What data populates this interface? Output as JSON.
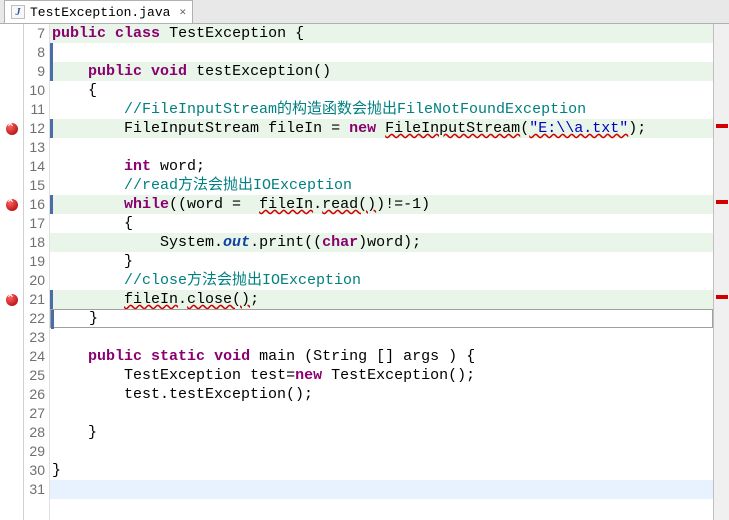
{
  "tab": {
    "filename": "TestException.java",
    "close_glyph": "✕"
  },
  "line_numbers": [
    "7",
    "8",
    "9",
    "10",
    "11",
    "12",
    "13",
    "14",
    "15",
    "16",
    "17",
    "18",
    "19",
    "20",
    "21",
    "22",
    "23",
    "24",
    "25",
    "26",
    "27",
    "28",
    "29",
    "30",
    "31"
  ],
  "gutter": {
    "error_lines": [
      12,
      16,
      21
    ]
  },
  "code": {
    "l7": {
      "kw1": "public",
      "kw2": "class",
      "name": "TestException",
      "brace": "{"
    },
    "l8": {
      "text": ""
    },
    "l9": {
      "kw1": "public",
      "kw2": "void",
      "name": "testException()"
    },
    "l10": {
      "brace": "{"
    },
    "l11": {
      "comment": "//FileInputStream的构造函数会抛出FileNotFoundException"
    },
    "l12": {
      "ty": "FileInputStream",
      "var": "fileIn",
      "eq": "=",
      "kw": "new",
      "ctor": "FileInputStream",
      "open": "(",
      "str": "\"E:\\\\a.txt\"",
      "close": ")",
      "semi": ";"
    },
    "l13": {
      "text": ""
    },
    "l14": {
      "kw": "int",
      "var": "word;"
    },
    "l15": {
      "comment": "//read方法会抛出IOException"
    },
    "l16": {
      "kw": "while",
      "open": "((word = ",
      "obj": "fileIn",
      "dot": ".",
      "meth": "read()",
      "rest": ")!=-1)"
    },
    "l17": {
      "brace": "{"
    },
    "l18": {
      "pre": "System.",
      "fld": "out",
      "mid": ".print((",
      "kw": "char",
      "post": ")word);"
    },
    "l19": {
      "brace": "}"
    },
    "l20": {
      "comment": "//close方法会抛出IOException"
    },
    "l21": {
      "obj": "fileIn",
      "dot": ".",
      "meth": "close()",
      "semi": ";"
    },
    "l22": {
      "brace": "}"
    },
    "l23": {
      "text": ""
    },
    "l24": {
      "kw1": "public",
      "kw2": "static",
      "kw3": "void",
      "name": "main",
      "args": "(String [] args )",
      "brace": "{"
    },
    "l25": {
      "ty": "TestException",
      "var": "test=",
      "kw": "new",
      "ctor": "TestException();"
    },
    "l26": {
      "text": "test.testException();"
    },
    "l27": {
      "text": ""
    },
    "l28": {
      "brace": "}"
    },
    "l29": {
      "text": ""
    },
    "l30": {
      "brace": "}"
    },
    "l31": {
      "text": ""
    }
  }
}
